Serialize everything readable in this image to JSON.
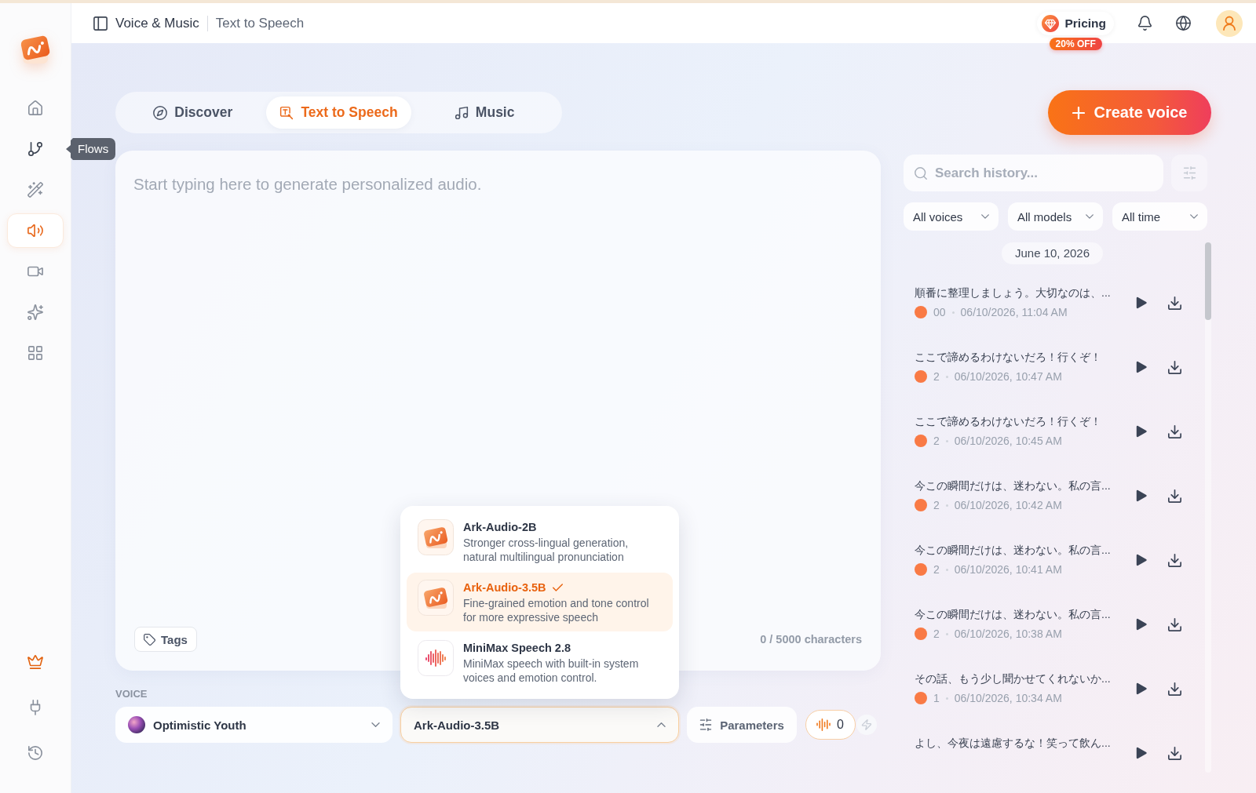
{
  "top_bar": {
    "breadcrumb": [
      "Voice & Music",
      "Text to Speech"
    ],
    "pricing": {
      "label": "Pricing",
      "badge": "20% OFF"
    }
  },
  "sidebar": {
    "items": [
      {
        "kind": "home",
        "selected": false
      },
      {
        "kind": "flows",
        "selected": false,
        "tooltip": "Flows"
      },
      {
        "kind": "magic",
        "selected": false
      },
      {
        "kind": "speech",
        "selected": true
      },
      {
        "kind": "video",
        "selected": false
      },
      {
        "kind": "sparkle",
        "selected": false
      },
      {
        "kind": "apps",
        "selected": false
      }
    ],
    "bottom_items": [
      {
        "kind": "upgrade"
      },
      {
        "kind": "plugin"
      },
      {
        "kind": "history"
      }
    ]
  },
  "tabs": [
    {
      "label": "Discover",
      "kind": "discover",
      "selected": false
    },
    {
      "label": "Text to Speech",
      "kind": "tts",
      "selected": true
    },
    {
      "label": "Music",
      "kind": "music",
      "selected": false
    }
  ],
  "create_button": "Create voice",
  "editor": {
    "placeholder": "Start typing here to generate personalized audio.",
    "tags_button": "Tags",
    "char_count": "0 / 5000 characters"
  },
  "voice": {
    "label": "VOICE",
    "value": "Optimistic Youth"
  },
  "model": {
    "value": "Ark-Audio-3.5B",
    "expanded": true,
    "options": [
      {
        "name": "Ark-Audio-2B",
        "description": "Stronger cross-lingual generation, natural multilingual pronunciation",
        "kind": "ark",
        "selected": false
      },
      {
        "name": "Ark-Audio-3.5B",
        "description": "Fine-grained emotion and tone control for more expressive speech",
        "kind": "ark",
        "selected": true
      },
      {
        "name": "MiniMax Speech 2.8",
        "description": "MiniMax speech with built-in system voices and emotion control.",
        "kind": "minimax",
        "selected": false
      }
    ]
  },
  "parameters_button": "Parameters",
  "credits": "0",
  "history": {
    "search_placeholder": "Search history...",
    "filters": [
      "All voices",
      "All models",
      "All time"
    ],
    "date": "June 10, 2026",
    "items": [
      {
        "text": "順番に整理しましょう。大切なのは、...",
        "voice": "00",
        "time": "06/10/2026, 11:04 AM"
      },
      {
        "text": "ここで諦めるわけないだろ！行くぞ！",
        "voice": "2",
        "time": "06/10/2026, 10:47 AM"
      },
      {
        "text": "ここで諦めるわけないだろ！行くぞ！",
        "voice": "2",
        "time": "06/10/2026, 10:45 AM"
      },
      {
        "text": "今この瞬間だけは、迷わない。私の言...",
        "voice": "2",
        "time": "06/10/2026, 10:42 AM"
      },
      {
        "text": "今この瞬間だけは、迷わない。私の言...",
        "voice": "2",
        "time": "06/10/2026, 10:41 AM"
      },
      {
        "text": "今この瞬間だけは、迷わない。私の言...",
        "voice": "2",
        "time": "06/10/2026, 10:38 AM"
      },
      {
        "text": "その話、もう少し聞かせてくれないか...",
        "voice": "1",
        "time": "06/10/2026, 10:34 AM"
      },
      {
        "text": "よし、今夜は遠慮するな！笑って飲ん..."
      }
    ]
  }
}
